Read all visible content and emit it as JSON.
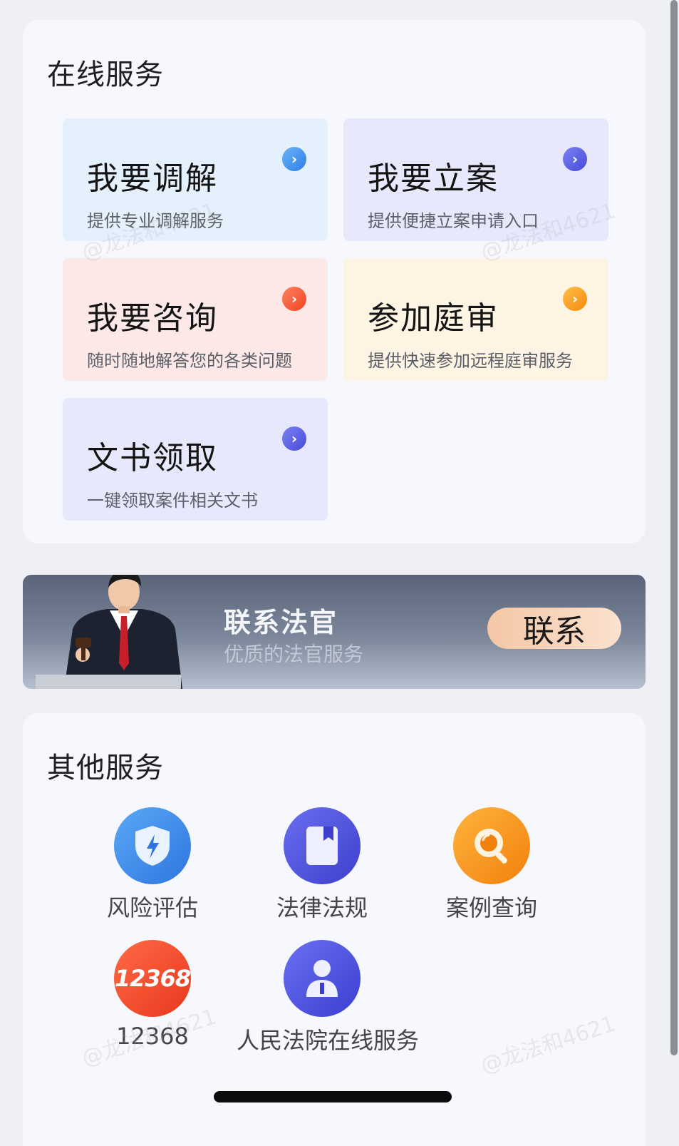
{
  "online_services": {
    "title": "在线服务",
    "tiles": [
      {
        "title": "我要调解",
        "desc": "提供专业调解服务"
      },
      {
        "title": "我要立案",
        "desc": "提供便捷立案申请入口"
      },
      {
        "title": "我要咨询",
        "desc": "随时随地解答您的各类问题"
      },
      {
        "title": "参加庭审",
        "desc": "提供快速参加远程庭审服务"
      },
      {
        "title": "文书领取",
        "desc": "一键领取案件相关文书"
      }
    ]
  },
  "banner": {
    "title": "联系法官",
    "subtitle": "优质的法官服务",
    "button": "联系"
  },
  "other_services": {
    "title": "其他服务",
    "items": [
      {
        "label": "风险评估",
        "icon": "shield-bolt-icon"
      },
      {
        "label": "法律法规",
        "icon": "book-icon"
      },
      {
        "label": "案例查询",
        "icon": "magnifier-icon"
      },
      {
        "label": "12368",
        "icon": "12368-badge-icon",
        "badge_text": "12368"
      },
      {
        "label": "人民法院在线服务",
        "icon": "person-icon"
      }
    ]
  },
  "watermark": "@龙法和4621"
}
